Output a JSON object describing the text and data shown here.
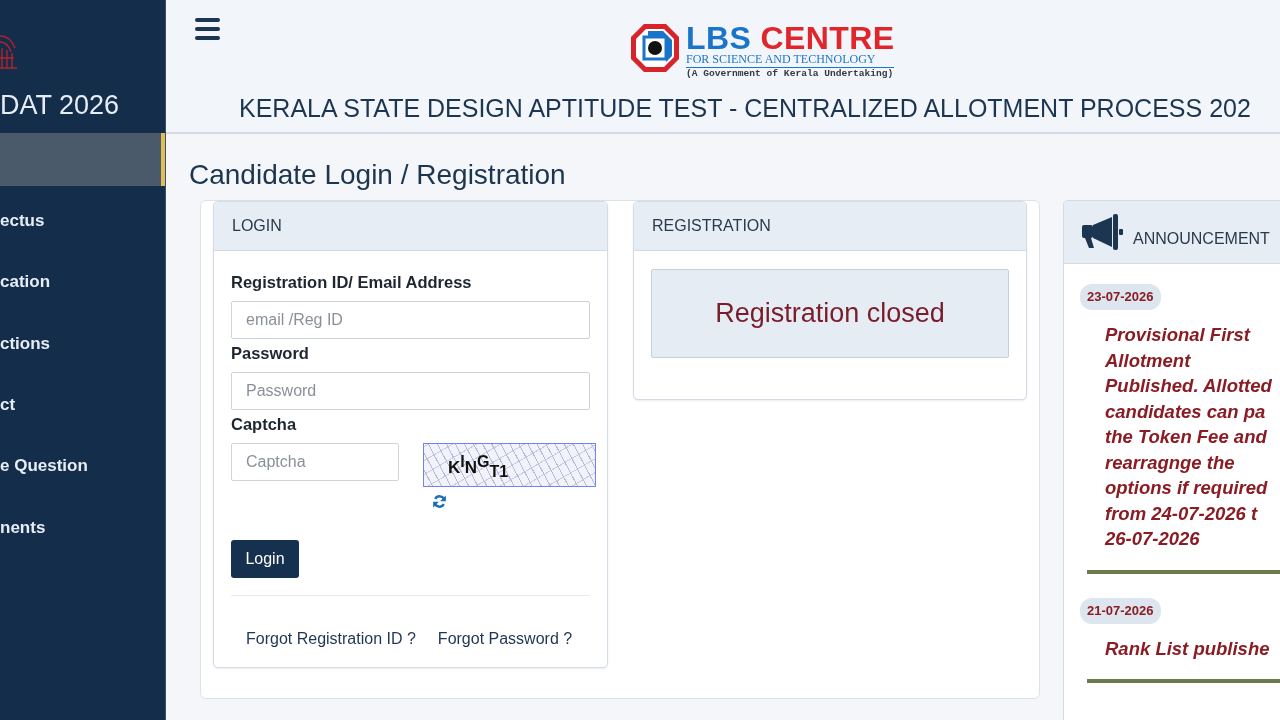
{
  "sidebar": {
    "brand": "DAT 2026",
    "items": [
      {
        "selected": true
      },
      {
        "label": "ectus",
        "selected": false
      },
      {
        "label": "cation",
        "selected": false
      },
      {
        "label": "ctions",
        "selected": false
      },
      {
        "label": "ct",
        "selected": false
      },
      {
        "label": "e Question",
        "selected": false
      },
      {
        "label": "nents",
        "selected": false
      }
    ]
  },
  "header": {
    "logo": {
      "title_words": [
        "LBS",
        "CENTRE"
      ],
      "tagline": "FOR SCIENCE AND TECHNOLOGY",
      "subtitle": "(A Government of Kerala Undertaking)"
    },
    "title": "KERALA STATE DESIGN APTITUDE TEST - CENTRALIZED ALLOTMENT PROCESS 202"
  },
  "page_title": "Candidate Login / Registration",
  "login": {
    "heading": "LOGIN",
    "fields": [
      {
        "kind": "input",
        "label": "Registration ID/ Email Address",
        "placeholder": "email /Reg ID"
      },
      {
        "kind": "input",
        "label": "Password",
        "placeholder": "Password"
      },
      {
        "kind": "captcha",
        "label": "Captcha",
        "placeholder": "Captcha"
      }
    ],
    "captcha_text": "K$^{I}$N$^{G}$$_{T1}$",
    "button": "Login",
    "links": [
      "Forgot Registration ID ?",
      "Forgot Password ?"
    ]
  },
  "registration": {
    "heading": "REGISTRATION",
    "notice": "Registration closed"
  },
  "announcements": {
    "heading": "ANNOUNCEMENT",
    "items": [
      {
        "date": "23-07-2026",
        "text": "Provisional First Allotment Published. Allotted candidates can pa the Token Fee and rearragnge the options if required from 24-07-2026 t 26-07-2026"
      },
      {
        "date": "21-07-2026",
        "text": "Rank List publishe"
      }
    ]
  }
}
